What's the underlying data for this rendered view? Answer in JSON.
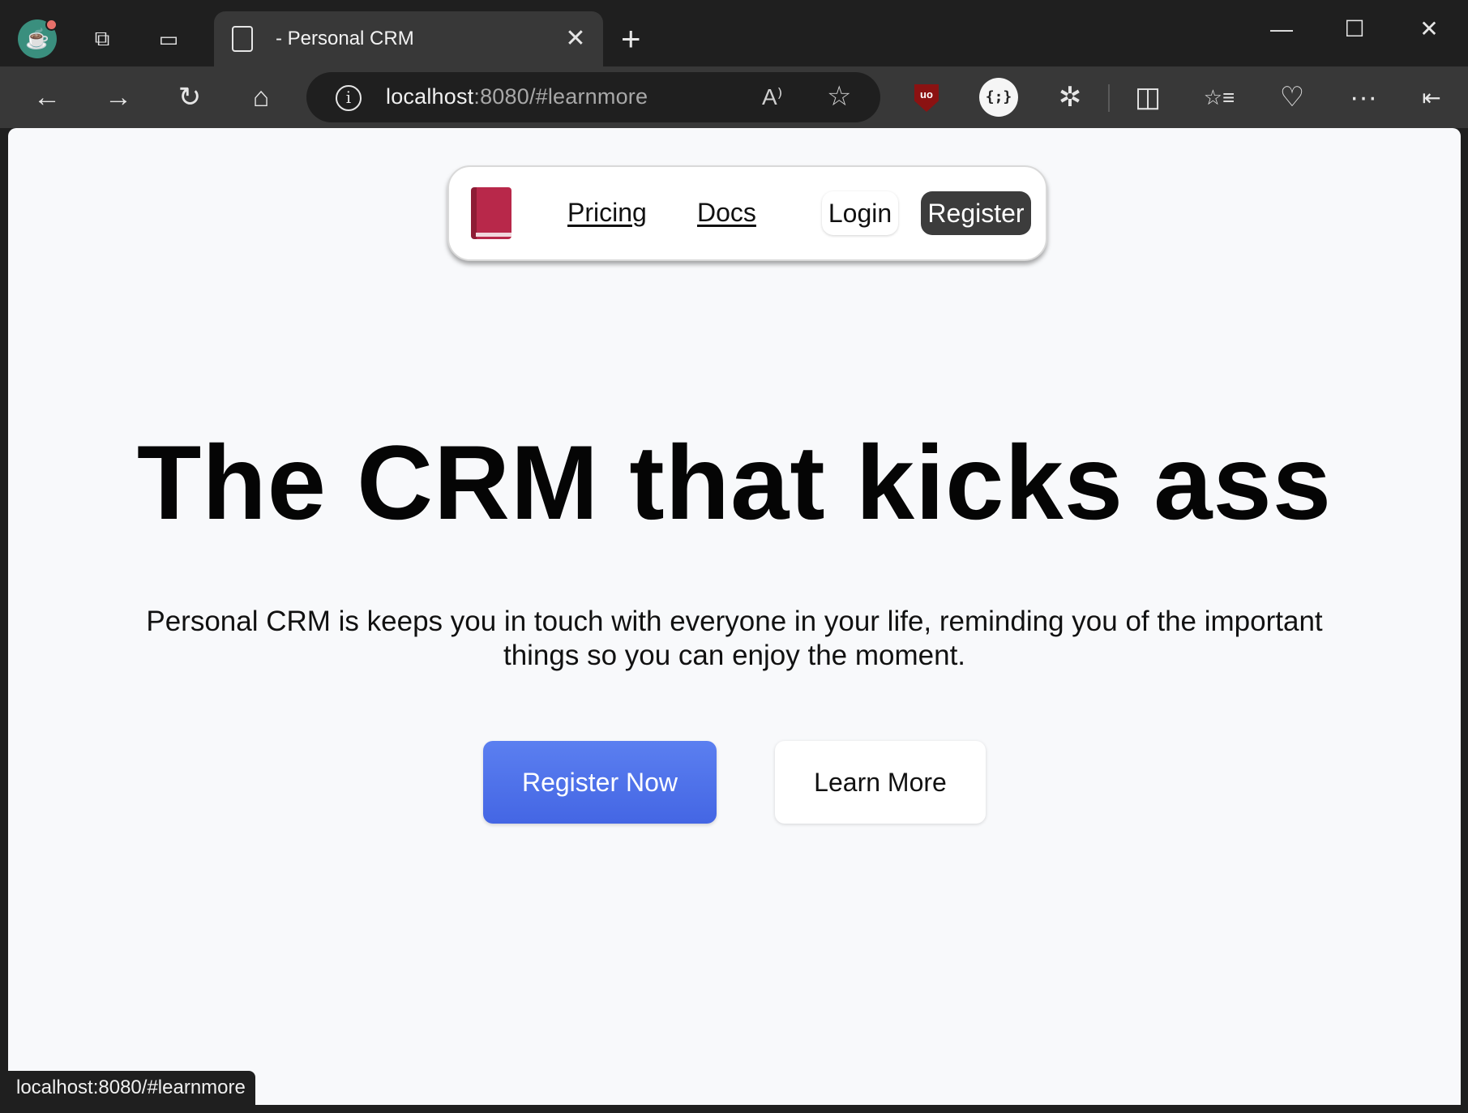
{
  "browser": {
    "tab": {
      "title": "- Personal CRM"
    },
    "address": {
      "host": "localhost",
      "rest": ":8080/#learnmore"
    },
    "status_url": "localhost:8080/#learnmore",
    "icons": {
      "back": "←",
      "forward": "→",
      "reload": "↻",
      "home": "⌂",
      "info": "i",
      "read_aloud": "A⁾",
      "favorite": "☆",
      "ublock": "uo",
      "json": "{;}",
      "extensions": "✲",
      "split": "◫",
      "favorites": "☆≡",
      "health": "♡",
      "more": "···",
      "sidebar": "⇤",
      "minimize": "—",
      "maximize": "☐",
      "close": "✕",
      "newtab": "+",
      "tab_close": "✕"
    }
  },
  "navbar": {
    "links": {
      "pricing": "Pricing",
      "docs": "Docs"
    },
    "login": "Login",
    "register": "Register"
  },
  "hero": {
    "title": "The CRM that kicks ass",
    "subtitle": "Personal CRM is keeps you in touch with everyone in your life, reminding you of the important things so you can enjoy the moment.",
    "primary_cta": "Register Now",
    "secondary_cta": "Learn More"
  },
  "colors": {
    "primary": "#4a6fe8",
    "dark_button": "#3c3c3c",
    "logo": "#b8284a"
  }
}
